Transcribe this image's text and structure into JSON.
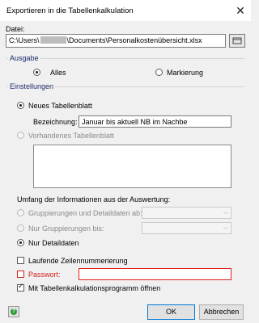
{
  "window": {
    "title": "Exportieren in die Tabellenkalkulation"
  },
  "file": {
    "label": "Datei:",
    "path_prefix": "C:\\Users\\",
    "path_suffix": "\\Documents\\Personalkostenübersicht.xlsx"
  },
  "ausgabe": {
    "title": "Ausgabe",
    "options": [
      "Alles",
      "Markierung"
    ],
    "selected": "Alles"
  },
  "einstellungen": {
    "title": "Einstellungen",
    "new_sheet_label": "Neues Tabellenblatt",
    "bezeichnung_label": "Bezeichnung:",
    "bezeichnung_value": "Januar bis aktuell NB im Nachbe",
    "existing_sheet_label": "Vorhandenes Tabellenblatt"
  },
  "umfang": {
    "label": "Umfang der Informationen aus der Auswertung:",
    "options": [
      "Gruppierungen und Detaildaten ab:",
      "Nur Gruppierungen bis:",
      "Nur Detaildaten"
    ],
    "selected": "Nur Detaildaten"
  },
  "options": {
    "line_numbering_label": "Laufende Zeilennummerierung",
    "password_label": "Passwort:",
    "password_value": "",
    "open_program_label": "Mit Tabellenkalkulationsprogramm öffnen"
  },
  "buttons": {
    "ok": "OK",
    "cancel": "Abbrechen",
    "close": "✕"
  },
  "colors": {
    "group_title": "#1d2c6b",
    "error": "#e02020",
    "accent": "#0078d7"
  }
}
